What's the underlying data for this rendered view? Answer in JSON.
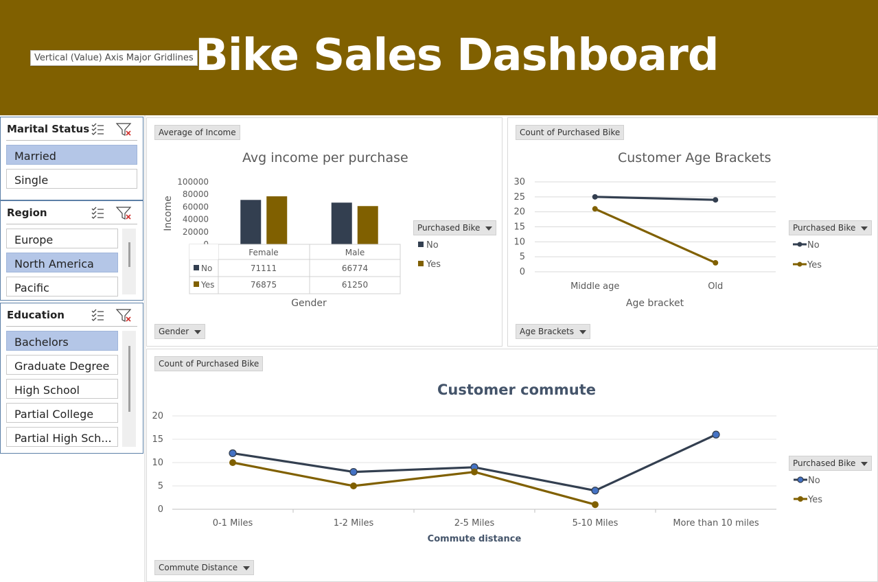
{
  "header": {
    "title": "Bike Sales Dashboard",
    "tooltip": "Vertical (Value) Axis Major Gridlines"
  },
  "colors": {
    "banner": "#806000",
    "no_series": "#333f50",
    "yes_series": "#806000",
    "selected_item": "#b4c6e7"
  },
  "slicers": {
    "marital": {
      "title": "Marital Status",
      "items": [
        {
          "label": "Married",
          "selected": true
        },
        {
          "label": "Single",
          "selected": false
        }
      ]
    },
    "region": {
      "title": "Region",
      "items": [
        {
          "label": "Europe",
          "selected": false
        },
        {
          "label": "North America",
          "selected": true
        },
        {
          "label": "Pacific",
          "selected": false
        }
      ]
    },
    "education": {
      "title": "Education",
      "items": [
        {
          "label": "Bachelors",
          "selected": true
        },
        {
          "label": "Graduate Degree",
          "selected": false
        },
        {
          "label": "High School",
          "selected": false
        },
        {
          "label": "Partial College",
          "selected": false
        },
        {
          "label": "Partial High Sch...",
          "selected": false
        }
      ]
    },
    "icons": [
      "multi-select-icon",
      "clear-filter-icon"
    ]
  },
  "income_chart": {
    "value_button": "Average of Income",
    "axis_button": "Gender",
    "legend_button": "Purchased Bike",
    "title": "Avg income per purchase",
    "ylabel": "Income",
    "xlabel": "Gender",
    "yticks": [
      "100000",
      "80000",
      "60000",
      "40000",
      "20000",
      "0"
    ],
    "legend": [
      "No",
      "Yes"
    ],
    "table": {
      "columns": [
        "Female",
        "Male"
      ],
      "rows": [
        {
          "name": "No",
          "values": [
            "71111",
            "66774"
          ]
        },
        {
          "name": "Yes",
          "values": [
            "76875",
            "61250"
          ]
        }
      ]
    }
  },
  "age_chart": {
    "value_button": "Count of Purchased Bike",
    "axis_button": "Age Brackets",
    "legend_button": "Purchased Bike",
    "title": "Customer Age Brackets",
    "xlabel": "Age bracket",
    "yticks": [
      "30",
      "25",
      "20",
      "15",
      "10",
      "5",
      "0"
    ],
    "categories": [
      "Middle age",
      "Old"
    ],
    "legend": [
      "No",
      "Yes"
    ]
  },
  "commute_chart": {
    "value_button": "Count of Purchased Bike",
    "axis_button": "Commute Distance",
    "legend_button": "Purchased Bike",
    "title": "Customer commute",
    "xlabel": "Commute distance",
    "yticks": [
      "20",
      "15",
      "10",
      "5",
      "0"
    ],
    "categories": [
      "0-1 Miles",
      "1-2 Miles",
      "2-5 Miles",
      "5-10 Miles",
      "More than 10 miles"
    ],
    "legend": [
      "No",
      "Yes"
    ]
  },
  "chart_data": [
    {
      "type": "bar",
      "title": "Avg income per purchase",
      "xlabel": "Gender",
      "ylabel": "Income",
      "categories": [
        "Female",
        "Male"
      ],
      "ylim": [
        0,
        100000
      ],
      "series": [
        {
          "name": "No",
          "values": [
            71111,
            66774
          ]
        },
        {
          "name": "Yes",
          "values": [
            76875,
            61250
          ]
        }
      ],
      "legend": "right"
    },
    {
      "type": "line",
      "title": "Customer Age Brackets",
      "xlabel": "Age bracket",
      "categories": [
        "Middle age",
        "Old"
      ],
      "ylim": [
        0,
        30
      ],
      "series": [
        {
          "name": "No",
          "values": [
            25,
            24
          ]
        },
        {
          "name": "Yes",
          "values": [
            21,
            3
          ]
        }
      ],
      "grid": true,
      "legend": "right"
    },
    {
      "type": "line",
      "title": "Customer commute",
      "xlabel": "Commute distance",
      "categories": [
        "0-1 Miles",
        "1-2 Miles",
        "2-5 Miles",
        "5-10 Miles",
        "More than 10 miles"
      ],
      "ylim": [
        0,
        20
      ],
      "series": [
        {
          "name": "No",
          "values": [
            12,
            8,
            9,
            4,
            16
          ]
        },
        {
          "name": "Yes",
          "values": [
            10,
            5,
            8,
            1,
            null
          ]
        }
      ],
      "grid": true,
      "legend": "right"
    }
  ]
}
